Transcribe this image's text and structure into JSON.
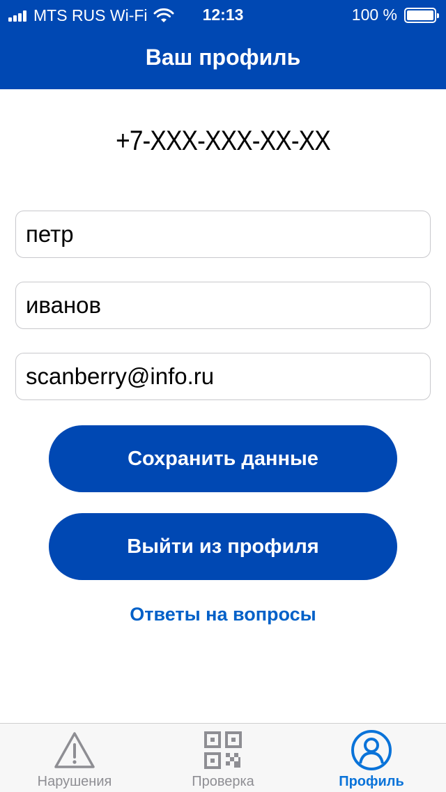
{
  "status_bar": {
    "carrier": "MTS RUS Wi-Fi",
    "time": "12:13",
    "battery": "100 %"
  },
  "header": {
    "title": "Ваш профиль"
  },
  "profile": {
    "phone": "+7-XXX-XXX-XX-XX",
    "first_name": "петр",
    "last_name": "иванов",
    "email": "scanberry@info.ru"
  },
  "actions": {
    "save_label": "Сохранить данные",
    "logout_label": "Выйти из профиля",
    "faq_label": "Ответы на вопросы"
  },
  "tabbar": {
    "tabs": [
      {
        "label": "Нарушения",
        "icon": "warning-icon",
        "active": false
      },
      {
        "label": "Проверка",
        "icon": "qr-code-icon",
        "active": false
      },
      {
        "label": "Профиль",
        "icon": "user-circle-icon",
        "active": true
      }
    ]
  },
  "colors": {
    "brand": "#0048b3",
    "link": "#0060c8",
    "tab_active": "#0a73d9",
    "tab_inactive": "#8e8e93"
  }
}
